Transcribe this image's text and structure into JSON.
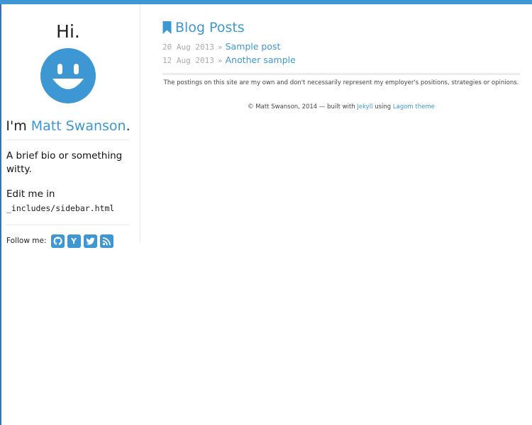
{
  "sidebar": {
    "greeting": "Hi.",
    "intro_prefix": "I'm ",
    "author_name": "Matt Swanson",
    "intro_suffix": ".",
    "bio": "A brief bio or something witty.",
    "edit_prefix": "Edit me in",
    "edit_path": "_includes/sidebar.html",
    "follow_label": "Follow me:",
    "social": [
      {
        "name": "github",
        "icon": "github-icon"
      },
      {
        "name": "hacker-news",
        "icon": "y-combinator-icon",
        "glyph": "Y"
      },
      {
        "name": "twitter",
        "icon": "twitter-icon"
      },
      {
        "name": "rss",
        "icon": "rss-icon"
      }
    ]
  },
  "main": {
    "title": "Blog Posts",
    "posts": [
      {
        "date": "20 Aug 2013",
        "separator": "»",
        "title": "Sample post"
      },
      {
        "date": "12 Aug 2013",
        "separator": "»",
        "title": "Another sample"
      }
    ],
    "disclaimer": "The postings on this site are my own and don't necessarily represent my employer's positions, strategies or opinions.",
    "footer": {
      "prefix": "© Matt Swanson, 2014 — built with ",
      "jekyll": "Jekyll",
      "middle": " using ",
      "theme": "Lagom theme"
    }
  },
  "colors": {
    "accent": "#3d97d3",
    "muted": "#aaaaaa",
    "divider": "#e6e6e6"
  }
}
